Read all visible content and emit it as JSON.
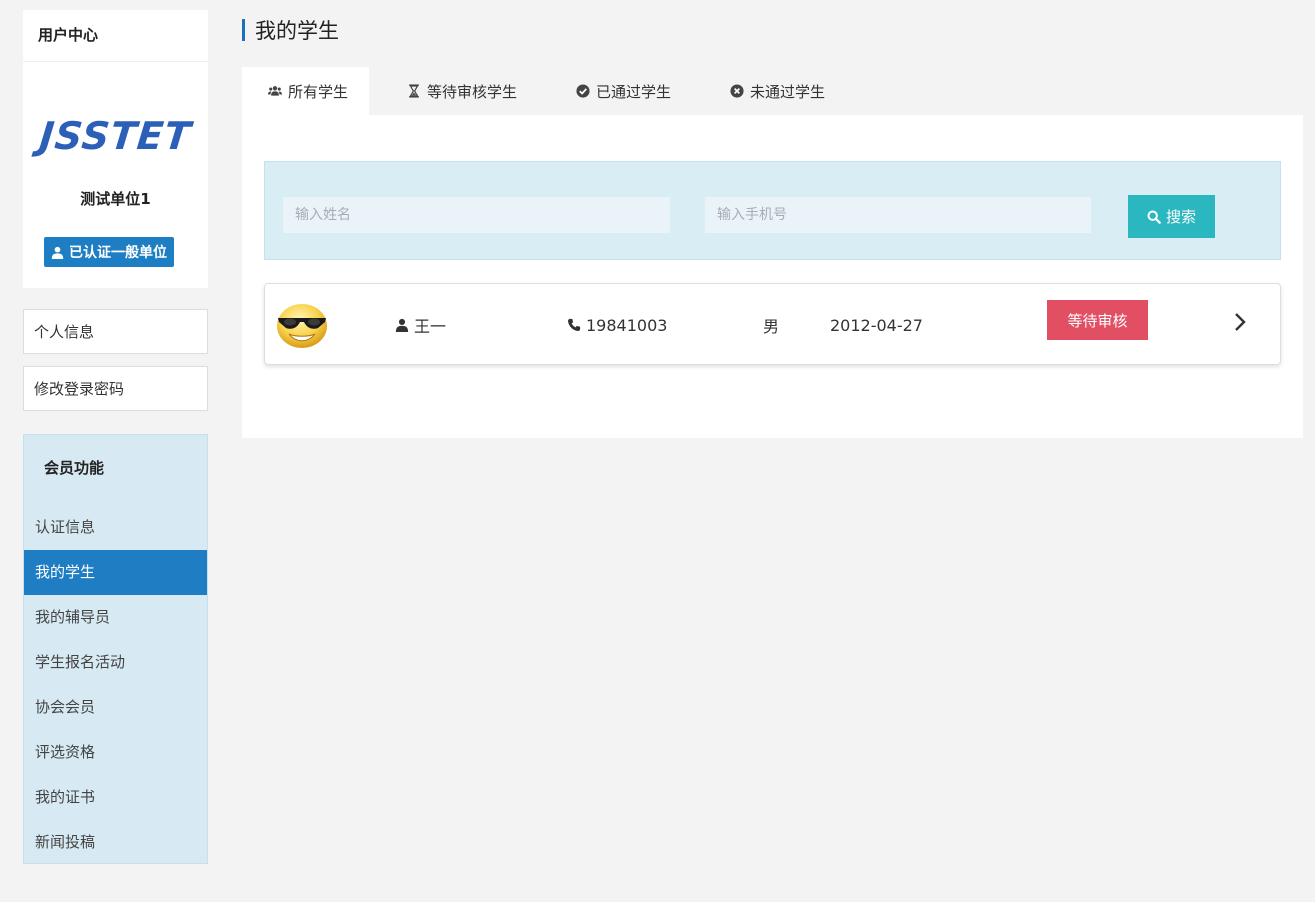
{
  "sidebar": {
    "user_center": "用户中心",
    "logo_text": "JSSTET",
    "unit_name": "测试单位1",
    "cert_badge": "已认证一般单位",
    "links": {
      "personal": "个人信息",
      "password": "修改登录密码"
    },
    "member_section": {
      "title": "会员功能",
      "items": [
        "认证信息",
        "我的学生",
        "我的辅导员",
        "学生报名活动",
        "协会会员",
        "评选资格",
        "我的证书",
        "新闻投稿"
      ],
      "active": "我的学生"
    }
  },
  "main": {
    "title": "我的学生",
    "tabs": [
      {
        "label": "所有学生",
        "icon": "users-icon",
        "active": true
      },
      {
        "label": "等待审核学生",
        "icon": "hourglass-icon",
        "active": false
      },
      {
        "label": "已通过学生",
        "icon": "check-circle-icon",
        "active": false
      },
      {
        "label": "未通过学生",
        "icon": "times-circle-icon",
        "active": false
      }
    ],
    "search": {
      "name_placeholder": "输入姓名",
      "phone_placeholder": "输入手机号",
      "button_label": "搜索"
    },
    "students": [
      {
        "name": "王一",
        "phone": "19841003",
        "gender": "男",
        "birth": "2012-04-27",
        "status": "等待审核"
      }
    ]
  },
  "colors": {
    "accent": "#1f7dc4",
    "search_button": "#2bb7c0",
    "status_pending": "#e24f63",
    "logo": "#2c5fb8"
  }
}
